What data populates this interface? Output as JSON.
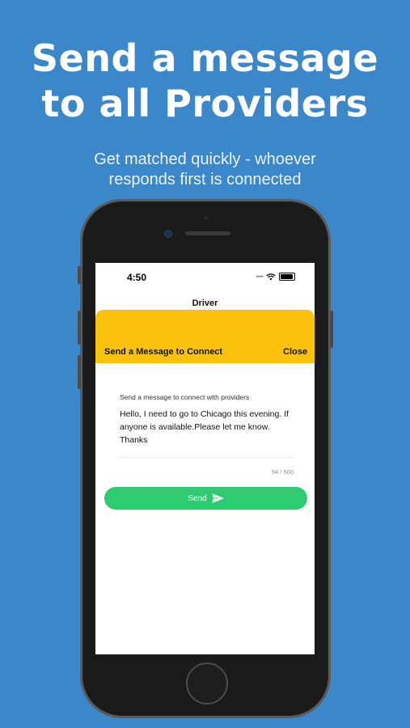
{
  "promo": {
    "headline_line1": "Send a message",
    "headline_line2": "to all Providers",
    "subline_line1": "Get matched quickly - whoever",
    "subline_line2": "responds first is connected"
  },
  "status_bar": {
    "time": "4:50",
    "icons": [
      "signal-dots-icon",
      "wifi-icon",
      "battery-icon"
    ]
  },
  "nav": {
    "title": "Driver"
  },
  "sheet": {
    "title": "Send a Message to Connect",
    "close_label": "Close"
  },
  "message_form": {
    "label": "Send a message to connect with providers",
    "value": "Hello, I need to go to Chicago this evening. If anyone is available.Please let me know. Thanks",
    "counter": "94 / 500",
    "send_label": "Send",
    "send_icon": "paper-plane-icon"
  },
  "colors": {
    "background": "#3b87c9",
    "sheet_header": "#fbc20d",
    "send_button": "#2ecc71"
  }
}
